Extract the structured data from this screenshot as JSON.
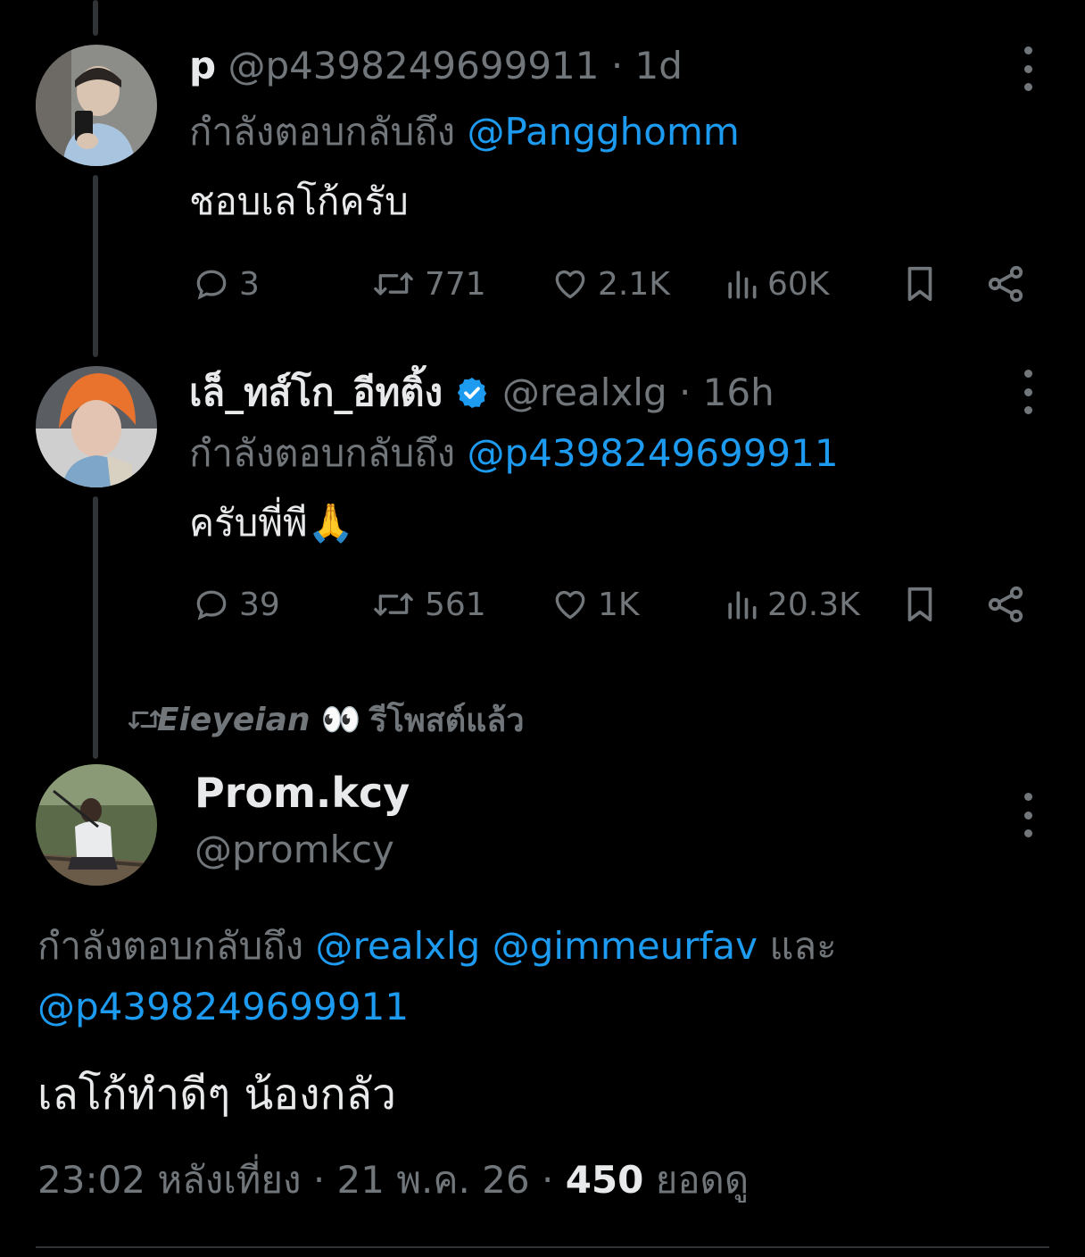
{
  "tweets": [
    {
      "display_name": "p",
      "handle": "@p4398249699911",
      "separator": " · ",
      "time": "1d",
      "reply_prefix": "กำลังตอบกลับถึง ",
      "reply_to": "@Pangghomm",
      "text": "ชอบเลโก้ครับ",
      "replies": "3",
      "reposts": "771",
      "likes": "2.1K",
      "views": "60K"
    },
    {
      "display_name": "เล็_ทส์โก_อีทติ้ง",
      "verified": true,
      "handle": "@realxlg",
      "separator": " · ",
      "time": "16h",
      "reply_prefix": "กำลังตอบกลับถึง ",
      "reply_to": "@p4398249699911",
      "text": "ครับพี่พี",
      "emoji": "🙏",
      "replies": "39",
      "reposts": "561",
      "likes": "1K",
      "views": "20.3K"
    }
  ],
  "repost_banner": {
    "user": "Eieyeian",
    "emoji": "👀",
    "label": "รีโพสต์แล้ว"
  },
  "main_tweet": {
    "display_name": "Prom.kcy",
    "handle": "@promkcy",
    "reply_prefix": "กำลังตอบกลับถึง ",
    "mention_1": "@realxlg",
    "mention_2": "@gimmeurfav",
    "and_word": "และ",
    "mention_3": "@p4398249699911",
    "text": "เลโก้ทำดีๆ น้องกลัว",
    "time": "23:02 หลังเที่ยง",
    "separator": " · ",
    "date": "21 พ.ค. 26",
    "views_count": "450",
    "views_label": "ยอดดู"
  },
  "colors": {
    "background": "#000000",
    "text": "#e7e9ea",
    "muted": "#71767b",
    "link": "#1d9bf0",
    "verified": "#1d9bf0"
  },
  "icons": [
    "reply-icon",
    "repost-icon",
    "like-icon",
    "views-icon",
    "bookmark-icon",
    "share-icon",
    "more-icon",
    "verified-badge-icon"
  ]
}
